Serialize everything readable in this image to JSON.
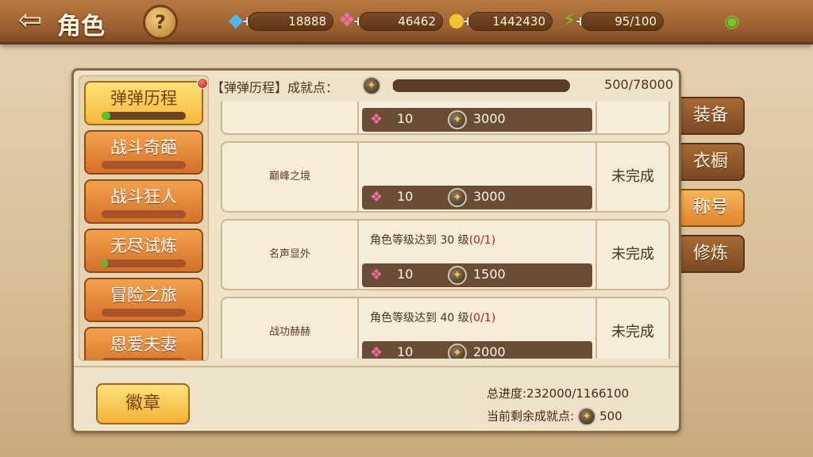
{
  "header": {
    "back_icon": "arrow-left-icon",
    "title": "角色",
    "help_label": "?"
  },
  "resources": [
    {
      "icon": "diamond-icon",
      "value": "18888"
    },
    {
      "icon": "pink-gem-icon",
      "value": "46462"
    },
    {
      "icon": "gold-coin-icon",
      "value": "1442430"
    },
    {
      "icon": "lightning-icon",
      "value": "95/100"
    }
  ],
  "side_tabs": [
    {
      "label": "装备",
      "active": false
    },
    {
      "label": "衣橱",
      "active": false
    },
    {
      "label": "称号",
      "active": true
    },
    {
      "label": "修炼",
      "active": false
    }
  ],
  "categories": [
    {
      "label": "弹弹历程",
      "active": true,
      "progress": 0.1
    },
    {
      "label": "战斗奇葩",
      "active": false,
      "progress": 0
    },
    {
      "label": "战斗狂人",
      "active": false,
      "progress": 0
    },
    {
      "label": "无尽试炼",
      "active": false,
      "progress": 0.08
    },
    {
      "label": "冒险之旅",
      "active": false,
      "progress": 0
    },
    {
      "label": "恩爱夫妻",
      "active": false,
      "progress": 0
    }
  ],
  "achievement_header": {
    "label": "【弹弹历程】成就点：",
    "points": "500/78000",
    "progress": 0.0064
  },
  "rows": [
    {
      "name": "",
      "requirement": "",
      "requirement_progress": "",
      "gem_reward": "10",
      "point_reward": "3000",
      "status": ""
    },
    {
      "name": "巅峰之境",
      "requirement": "",
      "requirement_progress": "",
      "gem_reward": "10",
      "point_reward": "3000",
      "status": "未完成"
    },
    {
      "name": "名声显外",
      "requirement": "角色等级达到 30 级",
      "requirement_progress": "(0/1)",
      "gem_reward": "10",
      "point_reward": "1500",
      "status": "未完成"
    },
    {
      "name": "战功赫赫",
      "requirement": "角色等级达到 40 级",
      "requirement_progress": "(0/1)",
      "gem_reward": "10",
      "point_reward": "2000",
      "status": "未完成"
    }
  ],
  "footer": {
    "badge_button": "徽章",
    "total_progress": "总进度:232000/1166100",
    "remaining_label": "当前剩余成就点:",
    "remaining_value": "500"
  },
  "colors": {
    "accent_orange": "#e0862e",
    "active_gold": "#f4b93a",
    "progress_green": "#55c22e",
    "progress_red": "#b2241a"
  }
}
